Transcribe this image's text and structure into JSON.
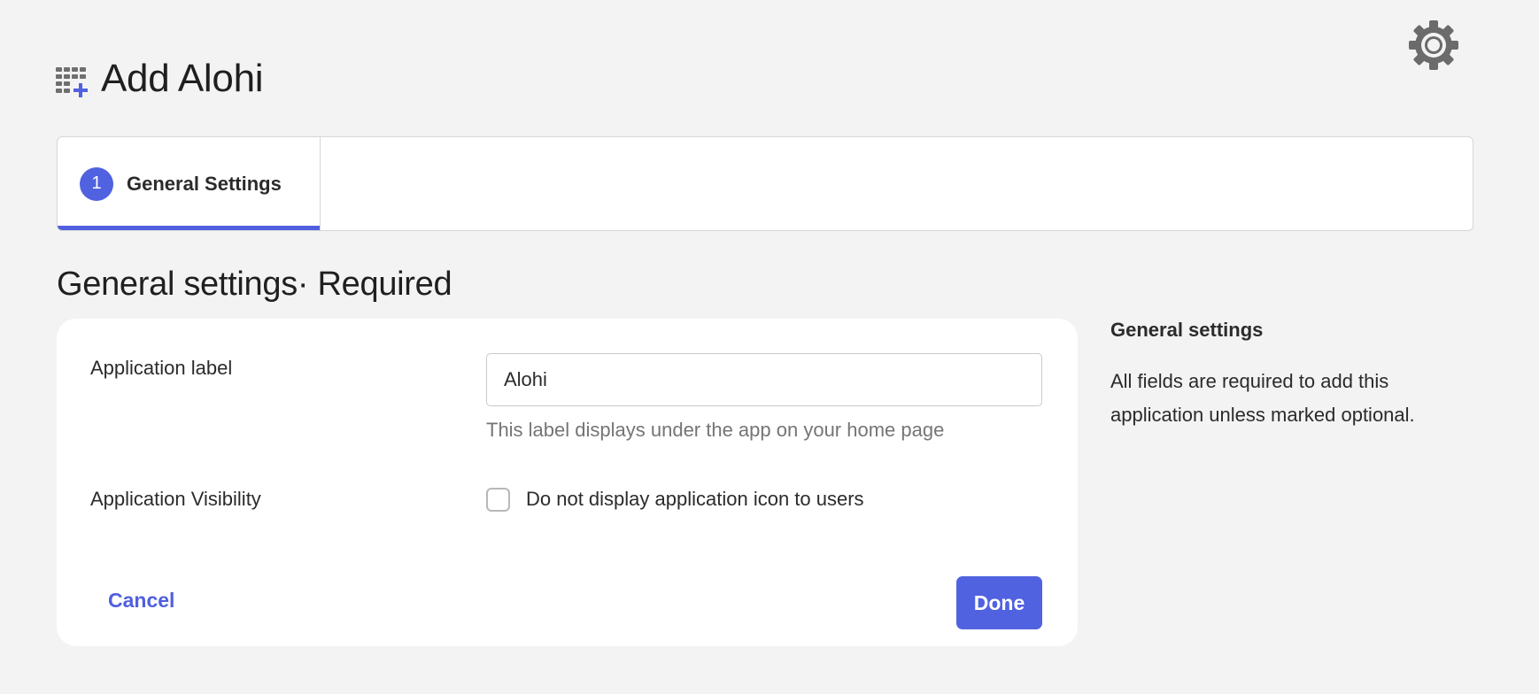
{
  "header": {
    "title": "Add Alohi",
    "icon": "app-add-icon",
    "settings_icon": "gear-icon"
  },
  "steps": [
    {
      "number": "1",
      "label": "General Settings",
      "active": true
    }
  ],
  "section": {
    "heading": "General settings· Required"
  },
  "form": {
    "app_label": {
      "label": "Application label",
      "value": "Alohi",
      "help": "This label displays under the app on your home page"
    },
    "visibility": {
      "label": "Application Visibility",
      "checkbox_label": "Do not display application icon to users",
      "checked": false
    },
    "cancel_label": "Cancel",
    "done_label": "Done"
  },
  "sidebar": {
    "title": "General settings",
    "text": "All fields are required to add this application unless marked optional."
  },
  "colors": {
    "accent": "#5062e0",
    "background": "#f3f3f3",
    "card": "#ffffff",
    "muted_text": "#757575"
  }
}
